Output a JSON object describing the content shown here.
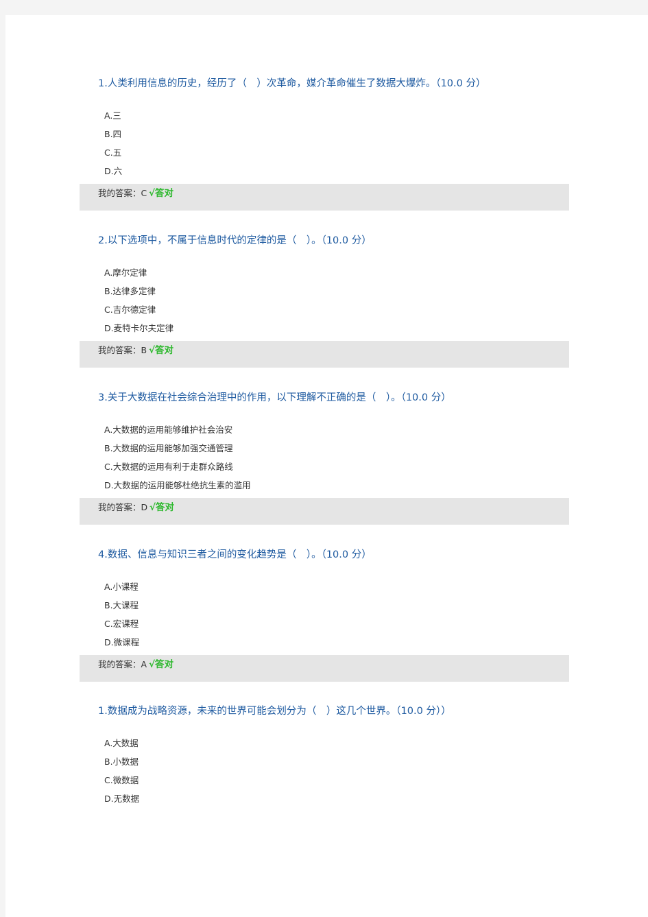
{
  "questions": [
    {
      "title": "1.人类利用信息的历史，经历了（　）次革命，媒介革命催生了数据大爆炸。（10.0 分）",
      "options": [
        "A.三",
        "B.四",
        "C.五",
        "D.六"
      ],
      "answer_label": "我的答案：C",
      "result": "√答对"
    },
    {
      "title": "2.以下选项中，不属于信息时代的定律的是（　）。（10.0 分）",
      "options": [
        "A.摩尔定律",
        "B.达律多定律",
        "C.吉尔德定律",
        "D.麦特卡尔夫定律"
      ],
      "answer_label": "我的答案：B",
      "result": "√答对"
    },
    {
      "title": "3.关于大数据在社会综合治理中的作用，以下理解不正确的是（　）。（10.0 分）",
      "options": [
        "A.大数据的运用能够维护社会治安",
        "B.大数据的运用能够加强交通管理",
        "C.大数据的运用有利于走群众路线",
        "D.大数据的运用能够杜绝抗生素的滥用"
      ],
      "answer_label": "我的答案：D",
      "result": "√答对"
    },
    {
      "title": "4.数据、信息与知识三者之间的变化趋势是（　）。（10.0 分）",
      "options": [
        "A.小课程",
        "B.大课程",
        "C.宏课程",
        "D.微课程"
      ],
      "answer_label": "我的答案：A",
      "result": "√答对"
    },
    {
      "title": "1.数据成为战略资源，未来的世界可能会划分为（　）这几个世界。（10.0 分））",
      "options": [
        "A.大数据",
        "B.小数据",
        "C.微数据",
        "D.无数据"
      ]
    }
  ]
}
